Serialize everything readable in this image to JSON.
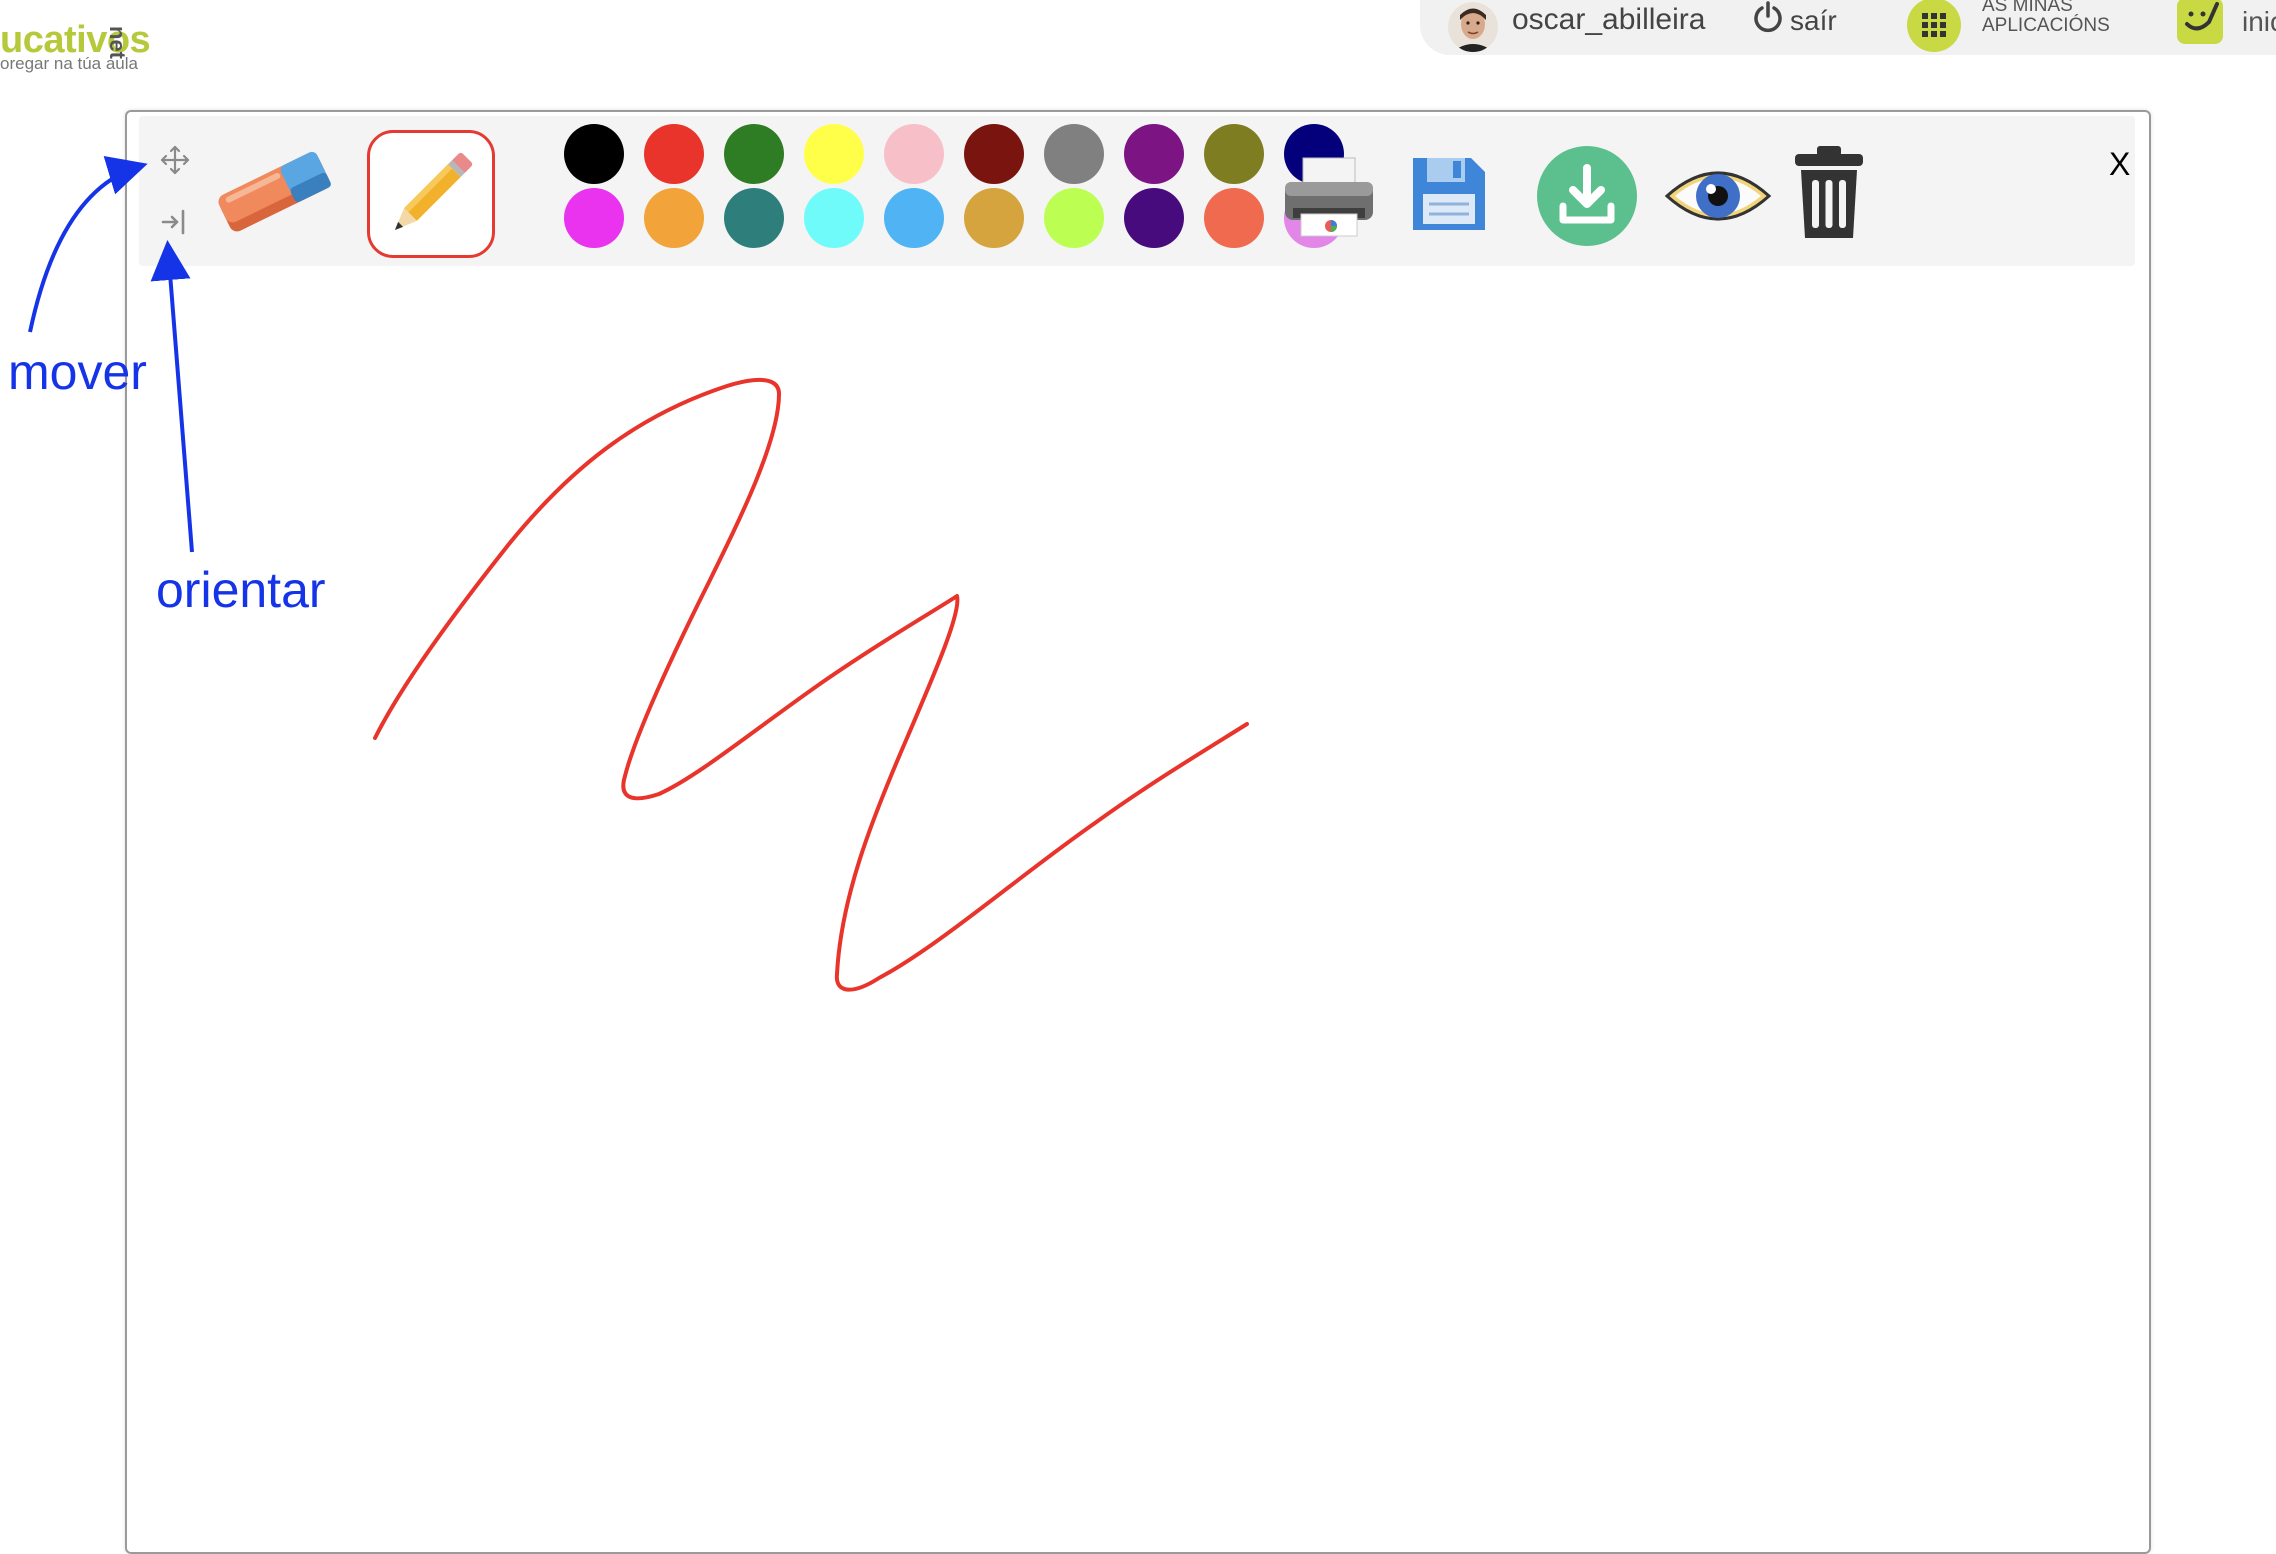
{
  "header": {
    "logo_main": "ucativos",
    "logo_suffix": "net",
    "logo_tagline": "oregar na túa aula",
    "user": {
      "name": "oscar_abilleira",
      "avatar_icon": "user-avatar"
    },
    "logout_label": "saír",
    "apps_label_line1": "AS MIÑAS",
    "apps_label_line2": "APLICACIÓNS",
    "home_label": "inic"
  },
  "toolbar": {
    "tools": [
      {
        "name": "move",
        "icon": "move-icon"
      },
      {
        "name": "orient",
        "icon": "dock-right-icon"
      },
      {
        "name": "eraser",
        "icon": "eraser-icon"
      },
      {
        "name": "pencil",
        "icon": "pencil-icon",
        "selected": true
      }
    ],
    "palette_row1": [
      "#000000",
      "#e8342a",
      "#2e7d24",
      "#ffff4a",
      "#f7c0c8",
      "#7a140e",
      "#808080",
      "#7c1484",
      "#7e7d22",
      "#04007c"
    ],
    "palette_row2": [
      "#ea33ee",
      "#f2a33a",
      "#2e7f7b",
      "#70fbfb",
      "#4fb3f4",
      "#d5a43e",
      "#bcff52",
      "#480b7e",
      "#ef6a4f",
      "#e286e8"
    ],
    "actions": [
      {
        "name": "print",
        "icon": "printer-icon"
      },
      {
        "name": "save",
        "icon": "floppy-icon"
      },
      {
        "name": "download",
        "icon": "download-icon"
      },
      {
        "name": "view",
        "icon": "eye-icon"
      },
      {
        "name": "delete",
        "icon": "trash-icon"
      }
    ],
    "close_label": "X"
  },
  "canvas": {
    "stroke_color": "#e8342a"
  },
  "annotations": {
    "move_label": "mover",
    "orient_label": "orientar",
    "color": "#1534e8"
  }
}
